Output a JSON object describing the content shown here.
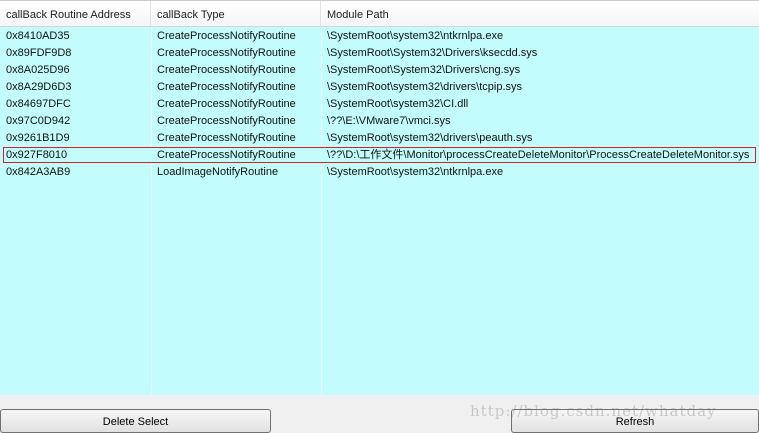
{
  "list": {
    "columns": [
      {
        "label": "callBack Routine Address"
      },
      {
        "label": "callBack Type"
      },
      {
        "label": "Module Path"
      }
    ],
    "rows": [
      {
        "address": "0x8410AD35",
        "type": "CreateProcessNotifyRoutine",
        "path": "\\SystemRoot\\system32\\ntkrnlpa.exe"
      },
      {
        "address": "0x89FDF9D8",
        "type": "CreateProcessNotifyRoutine",
        "path": "\\SystemRoot\\System32\\Drivers\\ksecdd.sys"
      },
      {
        "address": "0x8A025D96",
        "type": "CreateProcessNotifyRoutine",
        "path": "\\SystemRoot\\System32\\Drivers\\cng.sys"
      },
      {
        "address": "0x8A29D6D3",
        "type": "CreateProcessNotifyRoutine",
        "path": "\\SystemRoot\\system32\\drivers\\tcpip.sys"
      },
      {
        "address": "0x84697DFC",
        "type": "CreateProcessNotifyRoutine",
        "path": "\\SystemRoot\\system32\\CI.dll"
      },
      {
        "address": "0x97C0D942",
        "type": "CreateProcessNotifyRoutine",
        "path": "\\??\\E:\\VMware7\\vmci.sys"
      },
      {
        "address": "0x9261B1D9",
        "type": "CreateProcessNotifyRoutine",
        "path": "\\SystemRoot\\system32\\drivers\\peauth.sys"
      },
      {
        "address": "0x927F8010",
        "type": "CreateProcessNotifyRoutine",
        "path": "\\??\\D:\\工作文件\\Monitor\\processCreateDeleteMonitor\\ProcessCreateDeleteMonitor.sys"
      },
      {
        "address": "0x842A3AB9",
        "type": "LoadImageNotifyRoutine",
        "path": "\\SystemRoot\\system32\\ntkrnlpa.exe"
      }
    ],
    "selected_row": 7,
    "background_color": "#c3fcfd",
    "selection_border_color": "#d81f27"
  },
  "buttons": {
    "delete_label": "Delete Select",
    "refresh_label": "Refresh"
  },
  "watermark": {
    "text": "http://blog.csdn.net/whatday"
  }
}
